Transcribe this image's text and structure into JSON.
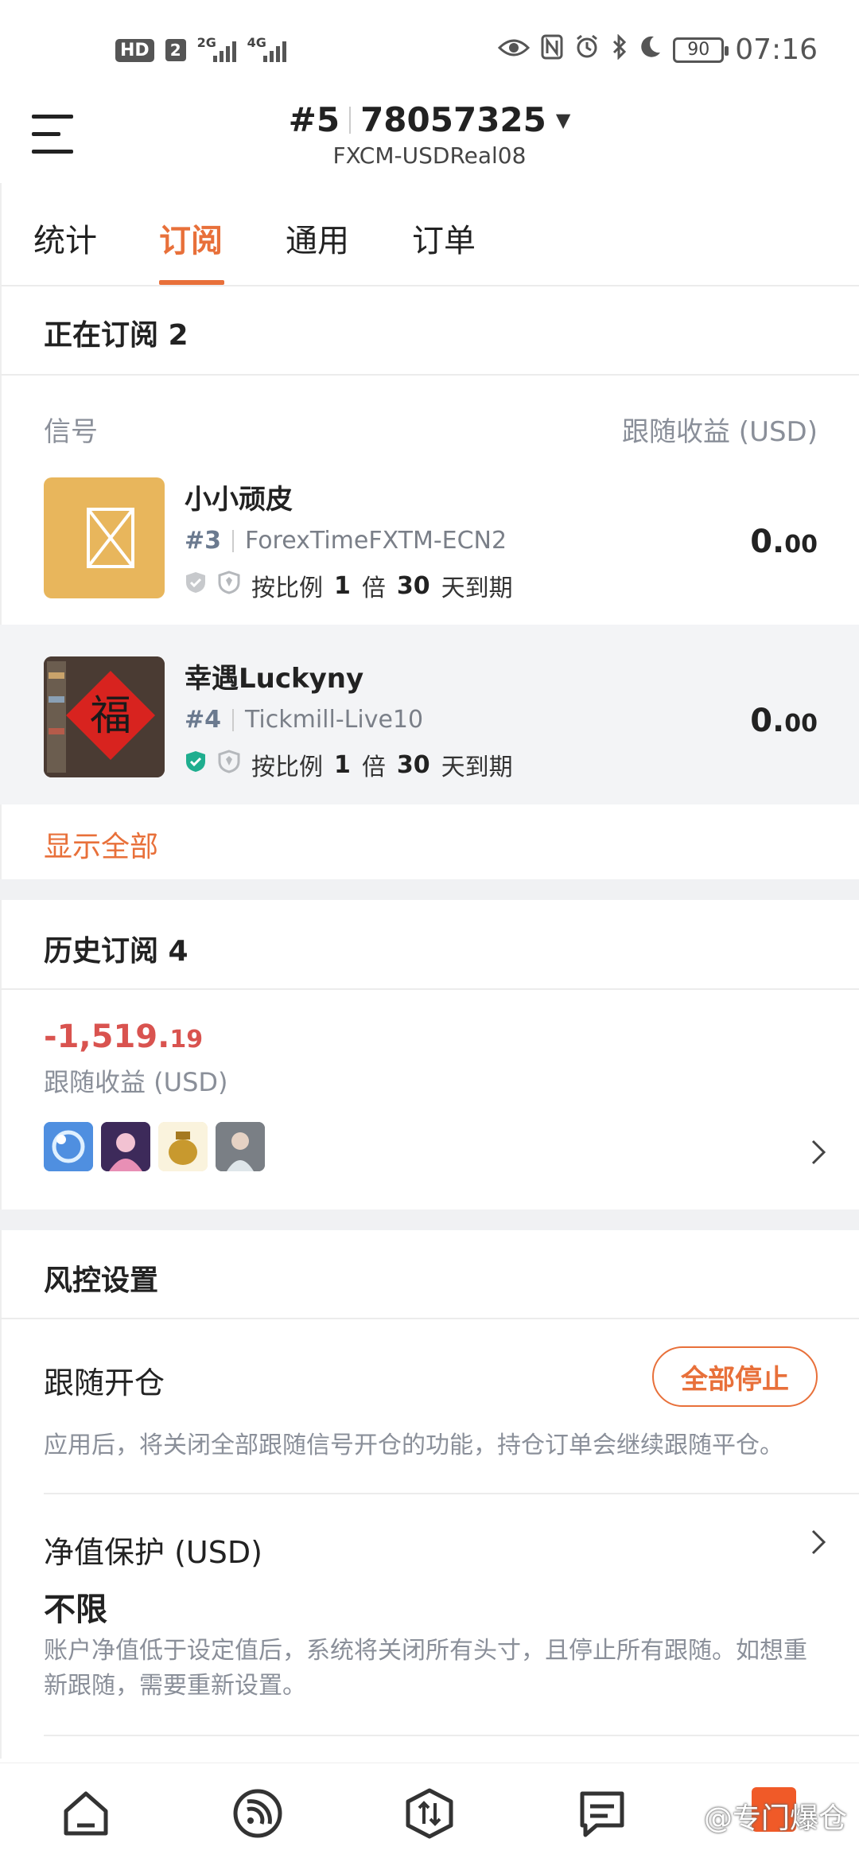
{
  "status_bar": {
    "hd_label": "HD",
    "hd_sub": "2",
    "net1": "2G",
    "net2": "4G",
    "battery": "90",
    "time": "07:16"
  },
  "header": {
    "account_index": "#5",
    "account_number": "78057325",
    "server": "FXCM-USDReal08"
  },
  "tabs": [
    {
      "label": "统计",
      "active": false
    },
    {
      "label": "订阅",
      "active": true
    },
    {
      "label": "通用",
      "active": false
    },
    {
      "label": "订单",
      "active": false
    }
  ],
  "active_subs": {
    "title": "正在订阅 2",
    "col_signal": "信号",
    "col_profit": "跟随收益 (USD)",
    "items": [
      {
        "name": "小小顽皮",
        "index": "#3",
        "broker": "ForexTimeFXTM-ECN2",
        "rule_prefix": "按比例",
        "rule_mult": "1",
        "rule_mult_unit": "倍",
        "rule_days": "30",
        "rule_suffix": "天到期",
        "value_int": "0.",
        "value_dec": "00",
        "verified": false
      },
      {
        "name": "幸遇Luckyny",
        "index": "#4",
        "broker": "Tickmill-Live10",
        "rule_prefix": "按比例",
        "rule_mult": "1",
        "rule_mult_unit": "倍",
        "rule_days": "30",
        "rule_suffix": "天到期",
        "value_int": "0.",
        "value_dec": "00",
        "verified": true
      }
    ],
    "show_all": "显示全部"
  },
  "history": {
    "title": "历史订阅 4",
    "pnl_int": "-1,519.",
    "pnl_dec": "19",
    "pnl_label": "跟随收益 (USD)"
  },
  "risk": {
    "title": "风控设置",
    "follow_open_label": "跟随开仓",
    "stop_all_label": "全部停止",
    "follow_open_desc": "应用后，将关闭全部跟随信号开仓的功能，持仓订单会继续跟随平仓。",
    "equity_label": "净值保护 (USD)",
    "equity_value": "不限",
    "equity_desc": "账户净值低于设定值后，系统将关闭所有头寸，且停止所有跟随。如想重新跟随，需要重新设置。"
  },
  "watermark": "@专门爆仓",
  "colors": {
    "accent": "#e8703a",
    "negative": "#d9534f",
    "verified": "#1fae8f"
  }
}
